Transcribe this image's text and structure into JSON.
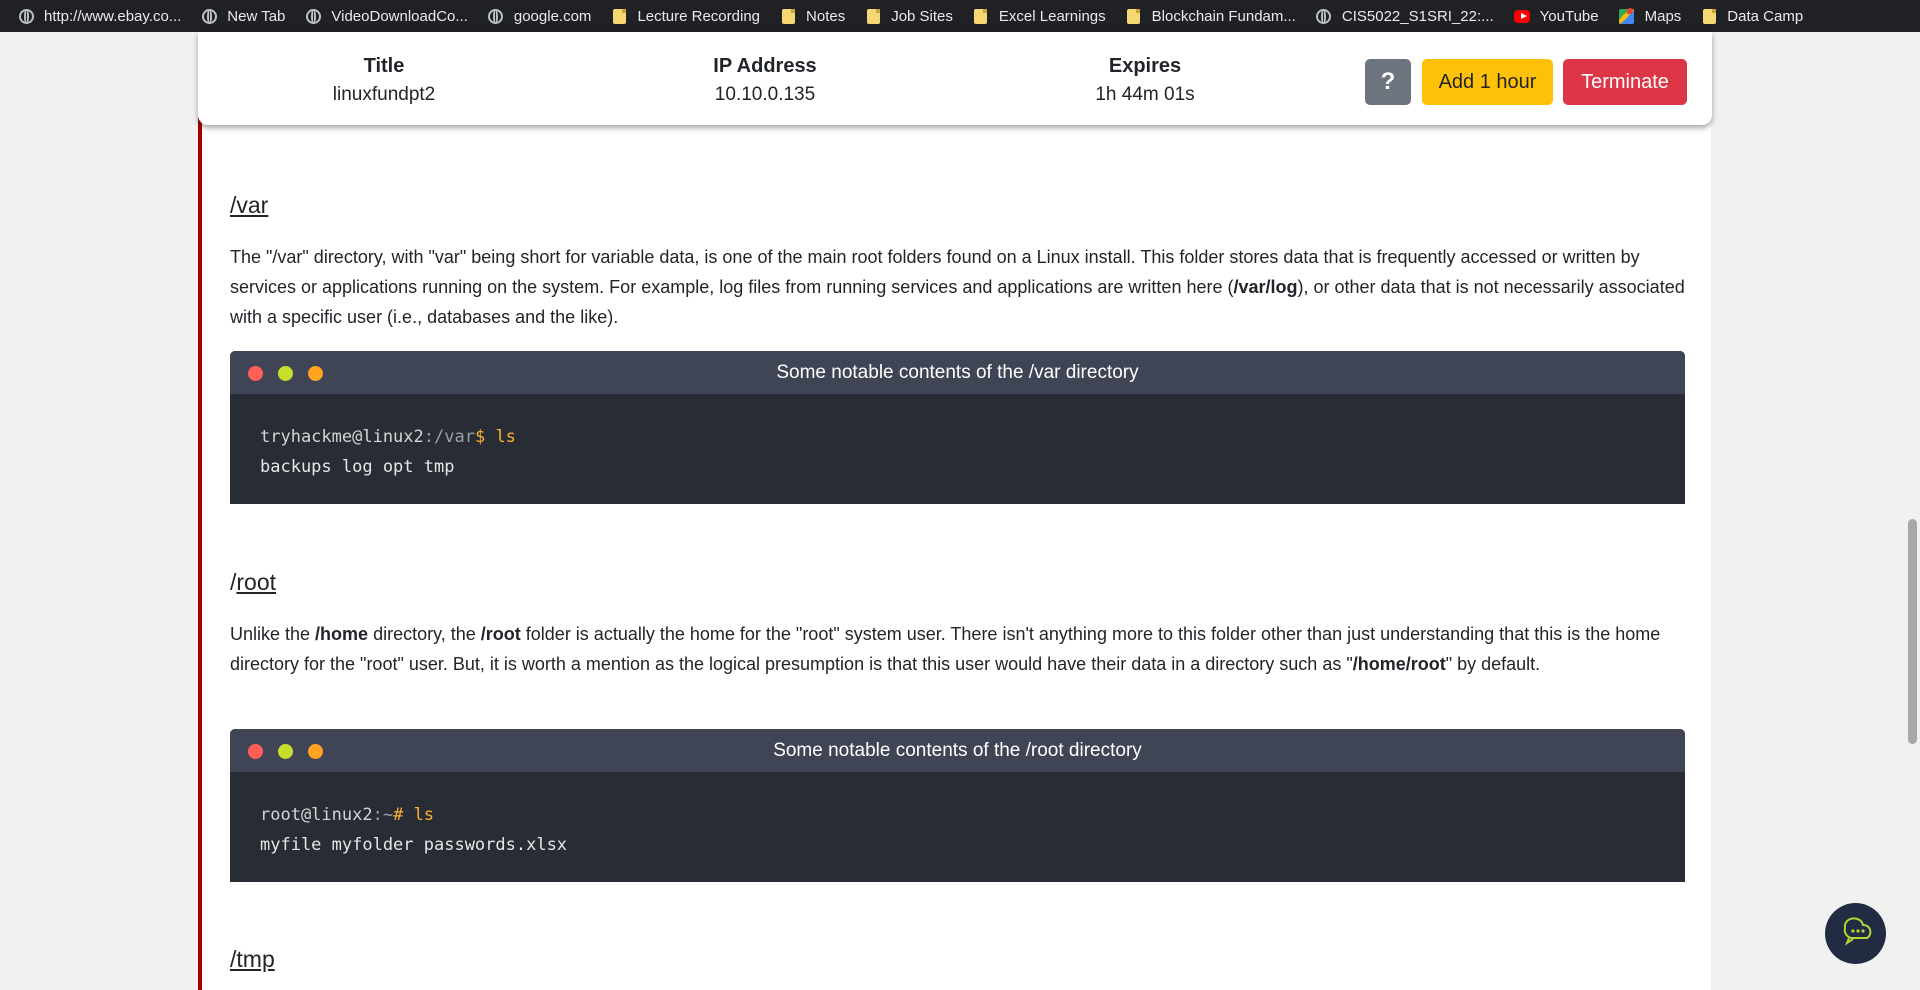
{
  "bookmarks": [
    {
      "label": "http://www.ebay.co...",
      "icon": "globe-icon"
    },
    {
      "label": "New Tab",
      "icon": "globe-icon"
    },
    {
      "label": "VideoDownloadCo...",
      "icon": "globe-icon"
    },
    {
      "label": "google.com",
      "icon": "globe-icon"
    },
    {
      "label": "Lecture Recording",
      "icon": "folder-icon"
    },
    {
      "label": "Notes",
      "icon": "folder-icon"
    },
    {
      "label": "Job Sites",
      "icon": "folder-icon"
    },
    {
      "label": "Excel Learnings",
      "icon": "folder-icon"
    },
    {
      "label": "Blockchain Fundam...",
      "icon": "folder-icon"
    },
    {
      "label": "CIS5022_S1SRI_22:...",
      "icon": "globe-icon"
    },
    {
      "label": "YouTube",
      "icon": "youtube-icon"
    },
    {
      "label": "Maps",
      "icon": "maps-icon"
    },
    {
      "label": "Data Camp",
      "icon": "folder-icon"
    }
  ],
  "machine": {
    "title_label": "Title",
    "title_value": "linuxfundpt2",
    "ip_label": "IP Address",
    "ip_value": "10.10.0.135",
    "expires_label": "Expires",
    "expires_value": "1h 44m 01s",
    "help_label": "?",
    "add_label": "Add 1 hour",
    "terminate_label": "Terminate"
  },
  "sections": {
    "var": {
      "heading": "/var",
      "para_1": "The \"/var\" directory, with \"var\" being short for variable data,  is one of the main root folders found on a Linux install. This folder stores data that is frequently accessed or written by services or applications running on the system. For example, log files from running services and applications are written here (",
      "para_bold": "/var/log",
      "para_2": "), or other data that is not necessarily associated with a specific user (i.e., databases and the like).",
      "terminal_title": "Some notable contents of the /var directory",
      "term_user": "tryhackme@linux2",
      "term_path": ":/var",
      "term_prompt": "$",
      "term_cmd": " ls",
      "term_output": "backups log opt tmp"
    },
    "root": {
      "heading_prefix": "/",
      "heading_link": "root",
      "para_a": "Unlike the ",
      "para_b": "/home",
      "para_c": " directory, the ",
      "para_d": "/root",
      "para_e": " folder is actually the home for the \"root\" system user. There isn't anything more to this folder other than just understanding that this is the home directory for the \"root\" user. But, it is worth a mention as the logical presumption is that this user would have their data in a directory such as \"",
      "para_f": "/home/root",
      "para_g": "\" by default.",
      "terminal_title": "Some notable contents of the /root directory",
      "term_user": "root@linux2",
      "term_path": ":~",
      "term_prompt": "#",
      "term_cmd": " ls",
      "term_output": "myfile myfolder passwords.xlsx"
    },
    "tmp": {
      "heading": "/tmp"
    }
  },
  "colors": {
    "accent_red": "#a40000",
    "terminal_bg": "#282c34",
    "terminal_header": "#3f4554",
    "prompt": "#ffb02e",
    "add_button": "#ffc107",
    "terminate_button": "#dc3545"
  }
}
